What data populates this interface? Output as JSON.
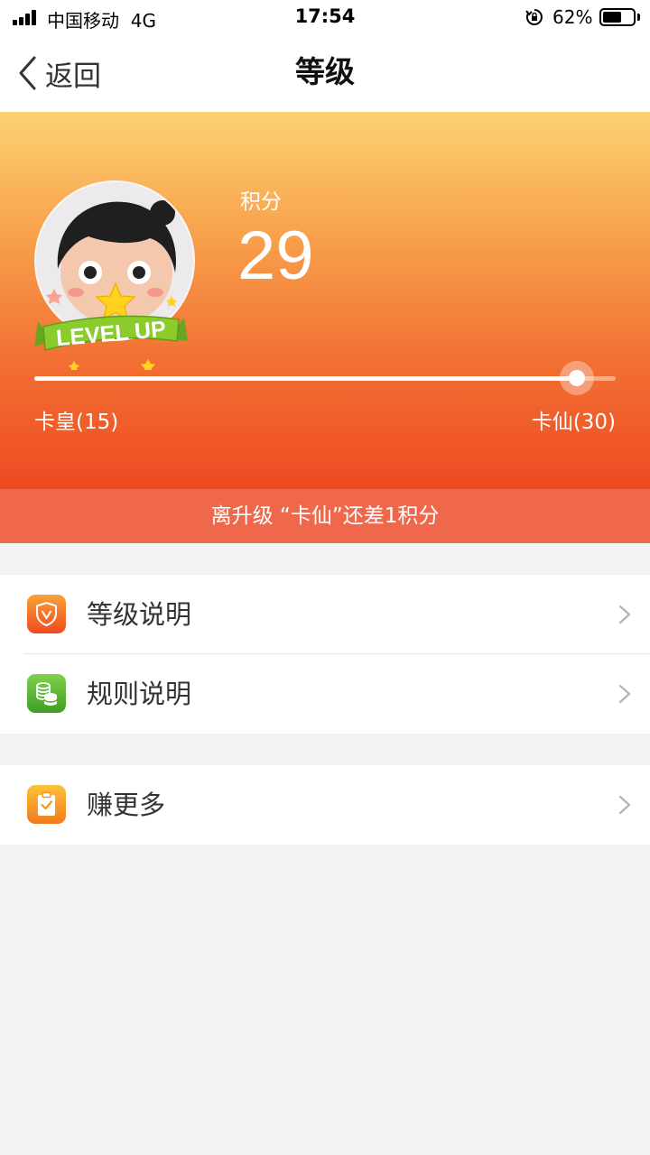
{
  "status_bar": {
    "carrier": "中国移动",
    "network": "4G",
    "time": "17:54",
    "battery_pct": "62%",
    "battery_level": 0.62
  },
  "nav": {
    "back_label": "返回",
    "title": "等级"
  },
  "hero": {
    "badge_text": "LEVEL UP",
    "points_label": "积分",
    "points_value": "29",
    "current_level": "卡皇(15)",
    "next_level": "卡仙(30)",
    "progress_fraction": 0.9333,
    "notice": "离升级 “卡仙”还差1积分",
    "colors": {
      "top": "#fdd172",
      "bottom": "#ee4a22",
      "notice_bg": "#ef684c"
    }
  },
  "menu_groups": [
    {
      "items": [
        {
          "label": "等级说明",
          "icon": "shield-icon",
          "icon_color": "#f15a29"
        },
        {
          "label": "规则说明",
          "icon": "coins-icon",
          "icon_color": "#4caf2b"
        }
      ]
    },
    {
      "items": [
        {
          "label": "赚更多",
          "icon": "clipboard-icon",
          "icon_color": "#f7941d"
        }
      ]
    }
  ]
}
